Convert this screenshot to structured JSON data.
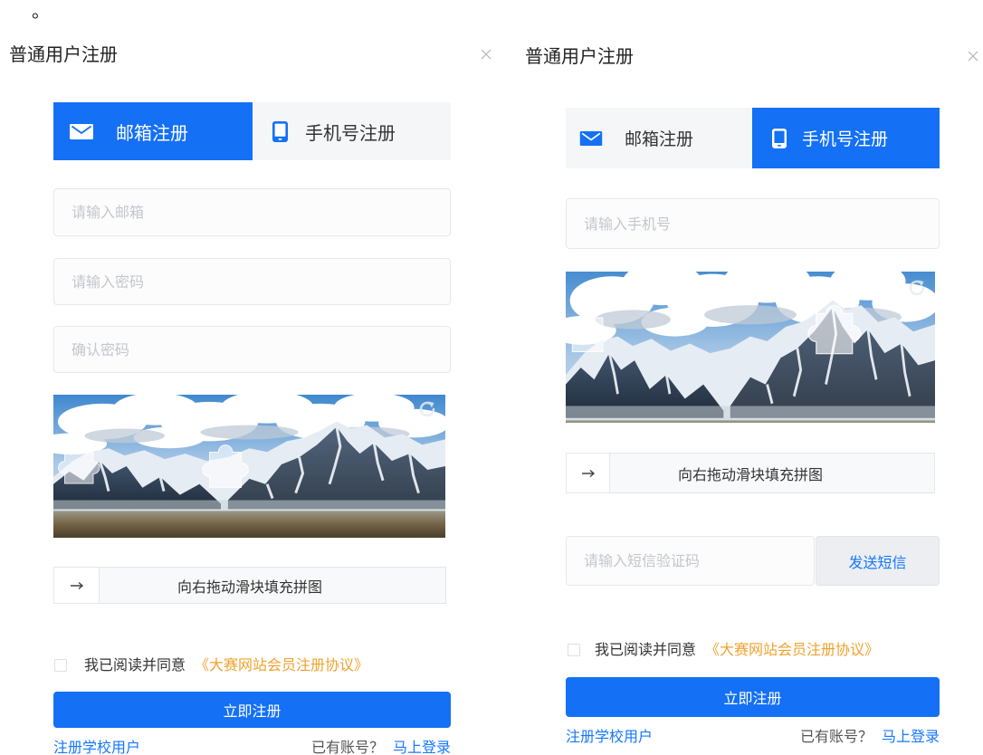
{
  "top_mark": "。",
  "colors": {
    "primary": "#1470f5",
    "link": "#1677ff",
    "agreement_link": "#f0a22e",
    "placeholder": "#c3c6cc",
    "tab_inactive_bg": "#f5f6f7",
    "sms_button_bg": "#eceef1"
  },
  "panels": [
    {
      "title": "普通用户注册",
      "close_icon": "close-icon",
      "tabs": [
        {
          "label": "邮箱注册",
          "icon": "envelope-icon",
          "active": true
        },
        {
          "label": "手机号注册",
          "icon": "phone-icon",
          "active": false
        }
      ],
      "fields": [
        {
          "placeholder": "请输入邮箱",
          "value": ""
        },
        {
          "placeholder": "请输入密码",
          "value": ""
        },
        {
          "placeholder": "确认密码",
          "value": ""
        }
      ],
      "captcha": {
        "refresh_icon": "refresh-icon",
        "handle_icon": "arrow-right-icon",
        "slider_hint": "向右拖动滑块填充拼图"
      },
      "agreement": {
        "checked": false,
        "text": "我已阅读并同意",
        "link": "《大赛网站会员注册协议》"
      },
      "submit_label": "立即注册",
      "footer": {
        "school_link": "注册学校用户",
        "has_account": "已有账号？",
        "login_link": "马上登录"
      }
    },
    {
      "title": "普通用户注册",
      "close_icon": "close-icon",
      "tabs": [
        {
          "label": "邮箱注册",
          "icon": "envelope-icon",
          "active": false
        },
        {
          "label": "手机号注册",
          "icon": "phone-icon",
          "active": true
        }
      ],
      "fields": [
        {
          "placeholder": "请输入手机号",
          "value": ""
        }
      ],
      "captcha": {
        "refresh_icon": "refresh-icon",
        "handle_icon": "arrow-right-icon",
        "slider_hint": "向右拖动滑块填充拼图"
      },
      "sms": {
        "placeholder": "请输入短信验证码",
        "value": "",
        "button_label": "发送短信"
      },
      "agreement": {
        "checked": false,
        "text": "我已阅读并同意",
        "link": "《大赛网站会员注册协议》"
      },
      "submit_label": "立即注册",
      "footer": {
        "school_link": "注册学校用户",
        "has_account": "已有账号？",
        "login_link": "马上登录"
      }
    }
  ]
}
